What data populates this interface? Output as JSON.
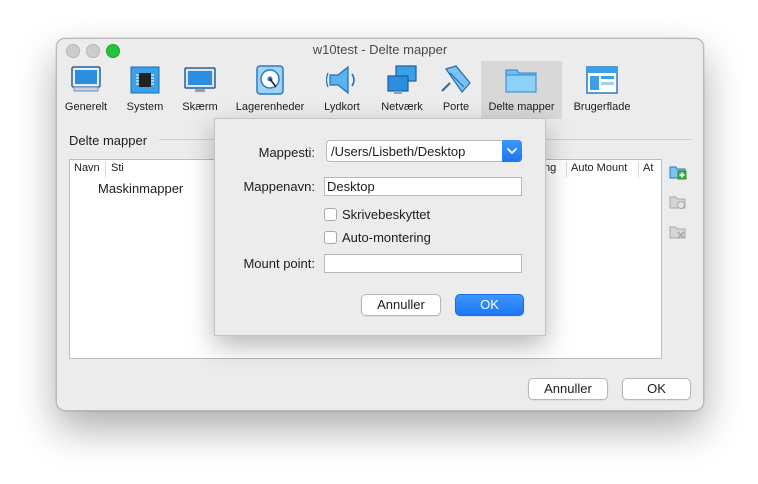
{
  "window": {
    "title": "w10test - Delte mapper"
  },
  "toolbar": {
    "items": [
      {
        "label": "Generelt",
        "icon": "general-monitor-icon"
      },
      {
        "label": "System",
        "icon": "chip-icon"
      },
      {
        "label": "Skærm",
        "icon": "display-icon"
      },
      {
        "label": "Lagerenheder",
        "icon": "storage-disk-icon"
      },
      {
        "label": "Lydkort",
        "icon": "speaker-icon"
      },
      {
        "label": "Netværk",
        "icon": "network-icon"
      },
      {
        "label": "Porte",
        "icon": "ports-icon"
      },
      {
        "label": "Delte mapper",
        "icon": "folder-icon",
        "selected": true
      },
      {
        "label": "Brugerflade",
        "icon": "ui-window-icon"
      }
    ]
  },
  "main": {
    "section_label": "Delte mapper",
    "table": {
      "columns": [
        "Navn",
        "Sti",
        "ng",
        "Auto Mount",
        "At"
      ],
      "rows": [
        {
          "label": "Maskinmapper"
        }
      ]
    },
    "cancel_label": "Annuller",
    "ok_label": "OK"
  },
  "sheet": {
    "path_label": "Mappesti:",
    "path_value": "/Users/Lisbeth/Desktop",
    "name_label": "Mappenavn:",
    "name_value": "Desktop",
    "readonly_label": "Skrivebeskyttet",
    "readonly_checked": false,
    "automount_label": "Auto-montering",
    "automount_checked": false,
    "mountpoint_label": "Mount point:",
    "mountpoint_value": "",
    "cancel_label": "Annuller",
    "ok_label": "OK"
  },
  "colors": {
    "accent": "#1b78f2",
    "zoom_button": "#29c23f",
    "window_bg": "#ececec"
  }
}
